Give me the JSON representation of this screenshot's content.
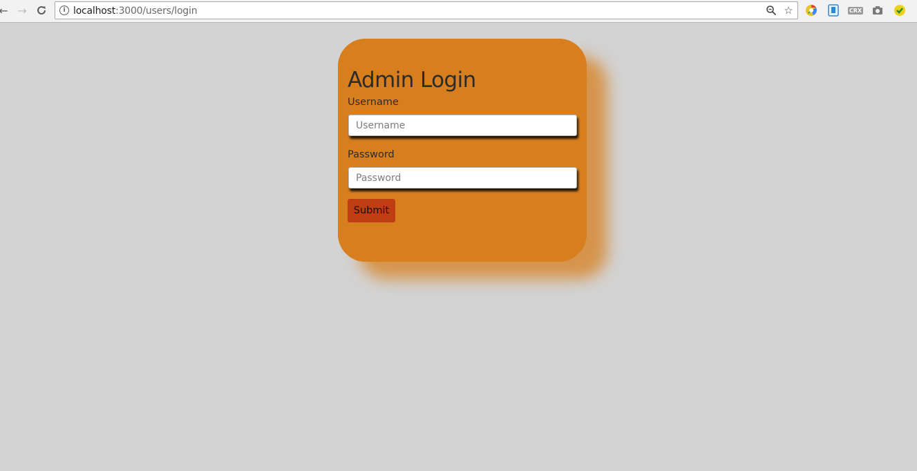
{
  "browser": {
    "back_glyph": "←",
    "forward_glyph": "→",
    "reload_glyph": "⟳",
    "url_host": "localhost",
    "url_path": ":3000/users/login",
    "zoom_glyph": "⚲",
    "star_glyph": "☆",
    "extensions": [
      "colorful-extension-icon",
      "blue-extension-icon",
      "crx-icon",
      "camera-icon",
      "green-extension-icon"
    ],
    "crx_label": "CRX"
  },
  "login": {
    "title": "Admin Login",
    "username_label": "Username",
    "username_placeholder": "Username",
    "username_value": "",
    "password_label": "Password",
    "password_placeholder": "Password",
    "password_value": "",
    "submit_label": "Submit"
  },
  "colors": {
    "background": "#d3d3d3",
    "card": "#d77f1e",
    "submit": "#c03d14"
  }
}
